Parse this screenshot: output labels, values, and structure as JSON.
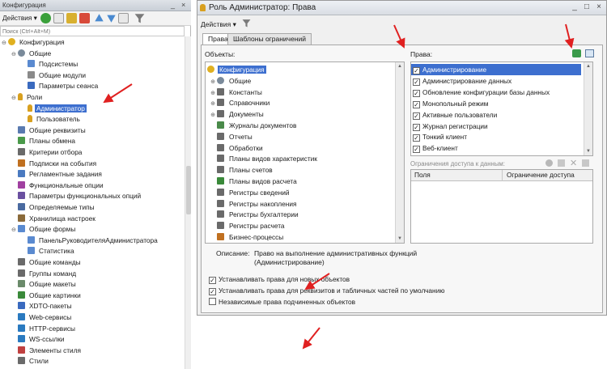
{
  "left_panel": {
    "title": "Конфигурация",
    "actions_label": "Действия",
    "search_placeholder": "Поиск (Ctrl+Alt+M)",
    "tree": [
      {
        "label": "Конфигурация",
        "exp": "⊖",
        "icon": "yellow-ring",
        "color": "#e0b020"
      },
      {
        "label": "Общие",
        "exp": "⊖",
        "icon": "gear",
        "color": "#7a8a9a"
      },
      {
        "label": "Подсистемы",
        "exp": "",
        "icon": "subsystem",
        "color": "#5a8ad0"
      },
      {
        "label": "Общие модули",
        "exp": "",
        "icon": "module",
        "color": "#8a8a8a"
      },
      {
        "label": "Параметры сеанса",
        "exp": "",
        "icon": "param",
        "color": "#3a6abf"
      },
      {
        "label": "Роли",
        "exp": "⊖",
        "icon": "key",
        "color": "#d8a020"
      },
      {
        "label": "Администратор",
        "exp": "",
        "icon": "key",
        "color": "#d8a020",
        "selected": true
      },
      {
        "label": "Пользователь",
        "exp": "",
        "icon": "key",
        "color": "#d8a020"
      },
      {
        "label": "Общие реквизиты",
        "exp": "",
        "icon": "attr",
        "color": "#5a7ab0"
      },
      {
        "label": "Планы обмена",
        "exp": "",
        "icon": "exchange",
        "color": "#4a9a4a"
      },
      {
        "label": "Критерии отбора",
        "exp": "",
        "icon": "filter",
        "color": "#6a6a6a"
      },
      {
        "label": "Подписки на события",
        "exp": "",
        "icon": "event",
        "color": "#c07020"
      },
      {
        "label": "Регламентные задания",
        "exp": "",
        "icon": "clock",
        "color": "#4a7ac0"
      },
      {
        "label": "Функциональные опции",
        "exp": "",
        "icon": "option",
        "color": "#a040a0"
      },
      {
        "label": "Параметры функциональных опций",
        "exp": "",
        "icon": "option-param",
        "color": "#6a50a0"
      },
      {
        "label": "Определяемые типы",
        "exp": "",
        "icon": "type",
        "color": "#4a6aa0"
      },
      {
        "label": "Хранилища настроек",
        "exp": "",
        "icon": "storage",
        "color": "#8a6a3a"
      },
      {
        "label": "Общие формы",
        "exp": "⊖",
        "icon": "form",
        "color": "#5a8ad0"
      },
      {
        "label": "ПанельРуководителяАдминистратора",
        "exp": "",
        "icon": "form",
        "color": "#5a8ad0"
      },
      {
        "label": "Статистика",
        "exp": "",
        "icon": "form",
        "color": "#5a8ad0"
      },
      {
        "label": "Общие команды",
        "exp": "",
        "icon": "command",
        "color": "#6a6a6a"
      },
      {
        "label": "Группы команд",
        "exp": "",
        "icon": "command-group",
        "color": "#6a6a6a"
      },
      {
        "label": "Общие макеты",
        "exp": "",
        "icon": "template",
        "color": "#6a8a6a"
      },
      {
        "label": "Общие картинки",
        "exp": "",
        "icon": "picture",
        "color": "#3a8a3a"
      },
      {
        "label": "XDTO-пакеты",
        "exp": "",
        "icon": "xdto",
        "color": "#3a6abf"
      },
      {
        "label": "Web-сервисы",
        "exp": "",
        "icon": "web",
        "color": "#2a7ac0"
      },
      {
        "label": "HTTP-сервисы",
        "exp": "",
        "icon": "http",
        "color": "#2a7ac0"
      },
      {
        "label": "WS-ссылки",
        "exp": "",
        "icon": "ws",
        "color": "#2a7ac0"
      },
      {
        "label": "Элементы стиля",
        "exp": "",
        "icon": "style",
        "color": "#c04040"
      },
      {
        "label": "Стили",
        "exp": "",
        "icon": "styles",
        "color": "#6a6a6a"
      }
    ]
  },
  "dialog": {
    "title": "Роль Администратор: Права",
    "actions_label": "Действия",
    "tabs": [
      "Права",
      "Шаблоны ограничений"
    ],
    "objects_label": "Объекты:",
    "rights_label": "Права:",
    "objects": [
      {
        "label": "Конфигурация",
        "exp": "⊖",
        "icon": "yellow-ring",
        "color": "#e0b020",
        "selected": true
      },
      {
        "label": "Общие",
        "exp": "⊕",
        "icon": "gear",
        "color": "#7a8a9a"
      },
      {
        "label": "Константы",
        "exp": "⊕",
        "icon": "const",
        "color": "#6a6a6a"
      },
      {
        "label": "Справочники",
        "exp": "⊕",
        "icon": "catalog",
        "color": "#6a6a6a"
      },
      {
        "label": "Документы",
        "exp": "⊕",
        "icon": "document",
        "color": "#6a6a6a"
      },
      {
        "label": "Журналы документов",
        "exp": "",
        "icon": "journal",
        "color": "#4a8a4a"
      },
      {
        "label": "Отчеты",
        "exp": "",
        "icon": "report",
        "color": "#6a6a6a"
      },
      {
        "label": "Обработки",
        "exp": "",
        "icon": "processing",
        "color": "#6a6a6a"
      },
      {
        "label": "Планы видов характеристик",
        "exp": "",
        "icon": "chart-types",
        "color": "#6a6a6a"
      },
      {
        "label": "Планы счетов",
        "exp": "",
        "icon": "accounts",
        "color": "#6a6a6a"
      },
      {
        "label": "Планы видов расчета",
        "exp": "",
        "icon": "calc-types",
        "color": "#3a8a3a"
      },
      {
        "label": "Регистры сведений",
        "exp": "",
        "icon": "register",
        "color": "#6a6a6a"
      },
      {
        "label": "Регистры накопления",
        "exp": "",
        "icon": "register",
        "color": "#6a6a6a"
      },
      {
        "label": "Регистры бухгалтерии",
        "exp": "",
        "icon": "register",
        "color": "#6a6a6a"
      },
      {
        "label": "Регистры расчета",
        "exp": "",
        "icon": "register",
        "color": "#6a6a6a"
      },
      {
        "label": "Бизнес-процессы",
        "exp": "",
        "icon": "business-process",
        "color": "#c07020"
      }
    ],
    "rights": [
      {
        "label": "Администрирование",
        "selected": true
      },
      {
        "label": "Администрирование данных"
      },
      {
        "label": "Обновление конфигурации базы данных"
      },
      {
        "label": "Монопольный режим"
      },
      {
        "label": "Активные пользователи"
      },
      {
        "label": "Журнал регистрации"
      },
      {
        "label": "Тонкий клиент"
      },
      {
        "label": "Веб-клиент"
      }
    ],
    "restrictions_label": "Ограничения доступа к данным:",
    "restrictions_columns": [
      "Поля",
      "Ограничение доступа"
    ],
    "description_label": "Описание:",
    "description_text": "Право на выполнение административных функций\n(Администрирование)",
    "checkboxes": [
      {
        "label": "Устанавливать права для новых объектов",
        "checked": true
      },
      {
        "label": "Устанавливать права для реквизитов и табличных частей по умолчанию",
        "checked": true
      },
      {
        "label": "Независимые права подчиненных объектов",
        "checked": false
      }
    ]
  },
  "colors": {
    "selection": "#3d6fcf",
    "annotation_arrow": "#e02020"
  }
}
